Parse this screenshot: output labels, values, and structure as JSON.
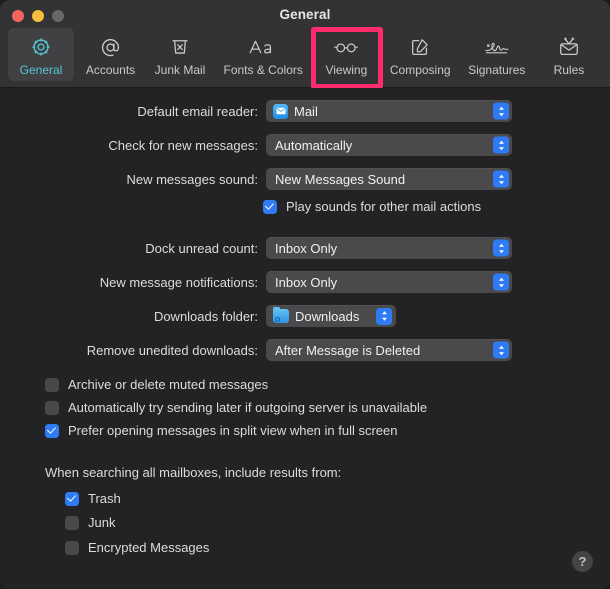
{
  "window": {
    "title": "General",
    "controls": [
      {
        "name": "close",
        "color": "#f5655b"
      },
      {
        "name": "minimize",
        "color": "#f6bd3f"
      },
      {
        "name": "zoom",
        "color": "#676769"
      }
    ]
  },
  "toolbar": {
    "selected": "General",
    "highlight_color": "#ff2d6e",
    "accent_color": "#54c7d6",
    "tabs": [
      {
        "label": "General",
        "icon": "gear-icon",
        "selected": true
      },
      {
        "label": "Accounts",
        "icon": "at-sign-icon",
        "selected": false
      },
      {
        "label": "Junk Mail",
        "icon": "trash-x-icon",
        "selected": false
      },
      {
        "label": "Fonts & Colors",
        "icon": "aa-text-icon",
        "selected": false
      },
      {
        "label": "Viewing",
        "icon": "glasses-icon",
        "selected": false,
        "highlighted": true
      },
      {
        "label": "Composing",
        "icon": "compose-pencil-icon",
        "selected": false
      },
      {
        "label": "Signatures",
        "icon": "signature-icon",
        "selected": false
      },
      {
        "label": "Rules",
        "icon": "envelope-arrows-icon",
        "selected": false
      }
    ]
  },
  "settings": {
    "rows": [
      {
        "label": "Default email reader:",
        "value": "Mail",
        "icon": "mail-app-icon",
        "width": "wide"
      },
      {
        "label": "Check for new messages:",
        "value": "Automatically",
        "icon": null,
        "width": "wide"
      },
      {
        "label": "New messages sound:",
        "value": "New Messages Sound",
        "icon": null,
        "width": "wide"
      },
      {
        "label": "Dock unread count:",
        "value": "Inbox Only",
        "icon": null,
        "width": "wide"
      },
      {
        "label": "New message notifications:",
        "value": "Inbox Only",
        "icon": null,
        "width": "wide"
      },
      {
        "label": "Downloads folder:",
        "value": "Downloads",
        "icon": "downloads-folder-icon",
        "width": "narrow"
      },
      {
        "label": "Remove unedited downloads:",
        "value": "After Message is Deleted",
        "icon": null,
        "width": "wide"
      }
    ],
    "play_sounds_checkbox": {
      "label": "Play sounds for other mail actions",
      "checked": true
    },
    "option_checkboxes": [
      {
        "label": "Archive or delete muted messages",
        "checked": false
      },
      {
        "label": "Automatically try sending later if outgoing server is unavailable",
        "checked": false
      },
      {
        "label": "Prefer opening messages in split view when in full screen",
        "checked": true
      }
    ],
    "search_section": {
      "heading": "When searching all mailboxes, include results from:",
      "items": [
        {
          "label": "Trash",
          "checked": true
        },
        {
          "label": "Junk",
          "checked": false
        },
        {
          "label": "Encrypted Messages",
          "checked": false
        }
      ]
    }
  },
  "help_button": {
    "label": "?"
  }
}
